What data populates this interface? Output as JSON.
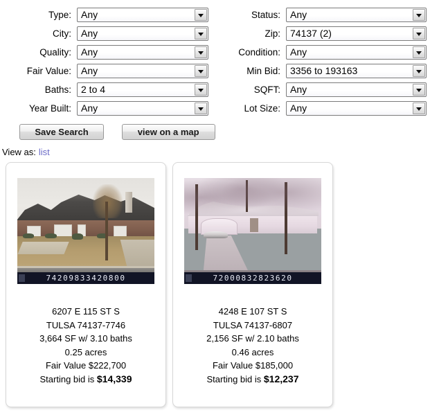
{
  "filters": {
    "left_column": [
      {
        "label": "Type:",
        "value": "Any"
      },
      {
        "label": "City:",
        "value": "Any"
      },
      {
        "label": "Quality:",
        "value": "Any"
      },
      {
        "label": "Fair Value:",
        "value": "Any"
      },
      {
        "label": "Baths:",
        "value": "2 to 4"
      },
      {
        "label": "Year Built:",
        "value": "Any"
      }
    ],
    "right_column": [
      {
        "label": "Status:",
        "value": "Any"
      },
      {
        "label": "Zip:",
        "value": "74137 (2)"
      },
      {
        "label": "Condition:",
        "value": "Any"
      },
      {
        "label": "Min Bid:",
        "value": "3356 to 193163"
      },
      {
        "label": "SQFT:",
        "value": "Any"
      },
      {
        "label": "Lot Size:",
        "value": "Any"
      }
    ]
  },
  "actions": {
    "save_search_label": "Save Search",
    "view_map_label": "view on a map"
  },
  "view_as": {
    "label": "View as:",
    "link_label": "list",
    "link_color": "#6b6bc8"
  },
  "results": [
    {
      "parcel": "74209833420800",
      "address": "6207 E 115 ST S",
      "city_zip": "TULSA 74137-7746",
      "size": "3,664 SF w/ 3.10 baths",
      "acres": "0.25 acres",
      "fair_value": "Fair Value $222,700",
      "bid_prefix": "Starting bid is",
      "bid_amount": "$14,339"
    },
    {
      "parcel": "72000832823620",
      "address": "4248 E 107 ST S",
      "city_zip": "TULSA 74137-6807",
      "size": "2,156 SF w/ 2.10 baths",
      "acres": "0.46 acres",
      "fair_value": "Fair Value $185,000",
      "bid_prefix": "Starting bid is",
      "bid_amount": "$12,237"
    }
  ]
}
